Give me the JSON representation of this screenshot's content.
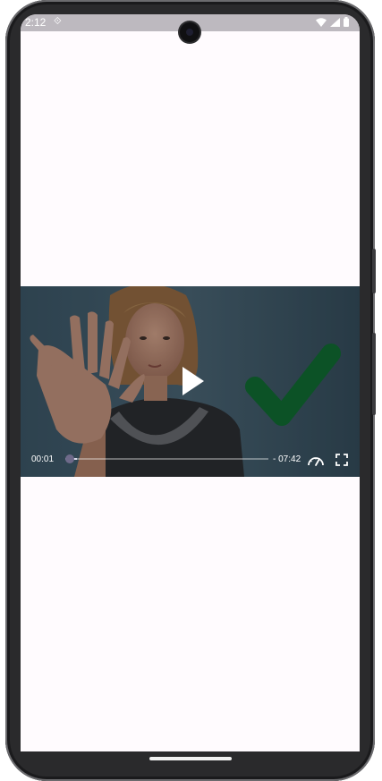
{
  "statusbar": {
    "time": "2:12",
    "nav_glyph": "⟐",
    "icons": [
      "wifi-icon",
      "signal-icon",
      "battery-icon"
    ]
  },
  "video": {
    "current_time": "00:01",
    "total_time": "- 07:42",
    "progress": 0.004,
    "thumbnail": "woman-stretching-fingers-with-green-checkmark",
    "checkmark_color": "#0d6b2c"
  },
  "colors": {
    "screen_bg": "#fffbfe",
    "statusbar_bg": "#bdb9bf",
    "seek_thumb": "#6e6a8a",
    "phone_frame": "#2a2a2c"
  }
}
